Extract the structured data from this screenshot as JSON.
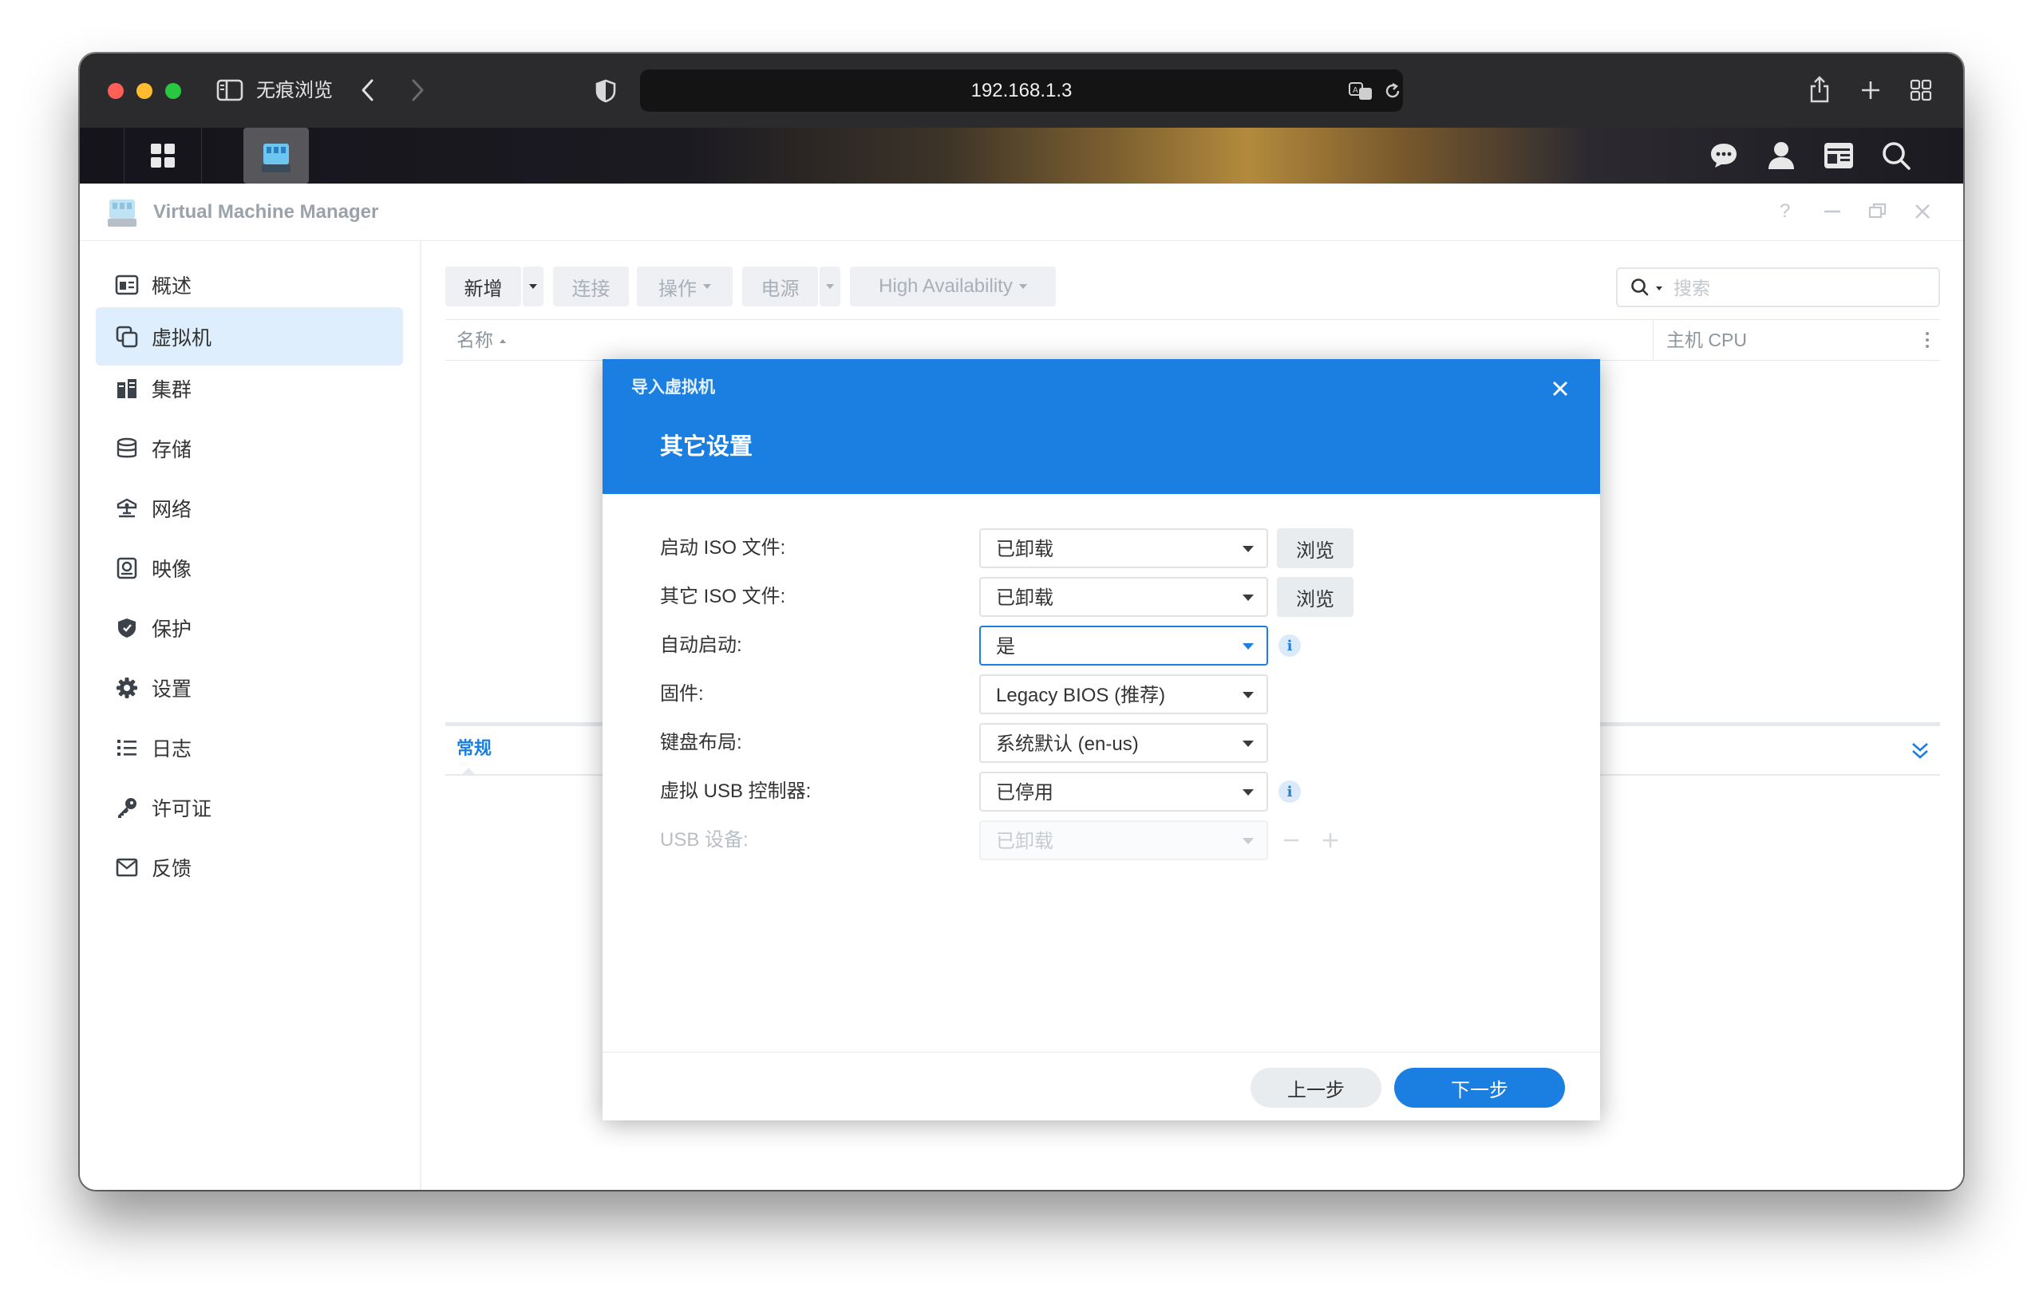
{
  "browser": {
    "private_label": "无痕浏览",
    "url": "192.168.1.3"
  },
  "app": {
    "title": "Virtual Machine Manager",
    "help": "?"
  },
  "sidebar": {
    "items": [
      {
        "label": "概述",
        "icon": "overview-icon"
      },
      {
        "label": "虚拟机",
        "icon": "virtual-machine-icon",
        "active": true
      },
      {
        "label": "集群",
        "icon": "cluster-icon"
      },
      {
        "label": "存储",
        "icon": "storage-icon"
      },
      {
        "label": "网络",
        "icon": "network-icon"
      },
      {
        "label": "映像",
        "icon": "image-icon"
      },
      {
        "label": "保护",
        "icon": "shield-icon"
      },
      {
        "label": "设置",
        "icon": "gear-icon"
      },
      {
        "label": "日志",
        "icon": "list-icon"
      },
      {
        "label": "许可证",
        "icon": "key-icon"
      },
      {
        "label": "反馈",
        "icon": "mail-icon"
      }
    ]
  },
  "toolbar": {
    "create": "新增",
    "connect": "连接",
    "action": "操作",
    "power": "电源",
    "ha": "High Availability",
    "search_placeholder": "搜索"
  },
  "grid": {
    "col_name": "名称",
    "col_host_cpu": "主机 CPU"
  },
  "lower_panel": {
    "tab_general": "常规"
  },
  "dialog": {
    "window_title": "导入虚拟机",
    "step_title": "其它设置",
    "rows": {
      "boot_iso": {
        "label": "启动 ISO 文件:",
        "value": "已卸载",
        "button": "浏览"
      },
      "other_iso": {
        "label": "其它 ISO 文件:",
        "value": "已卸载",
        "button": "浏览"
      },
      "autostart": {
        "label": "自动启动:",
        "value": "是"
      },
      "firmware": {
        "label": "固件:",
        "value": "Legacy BIOS (推荐)"
      },
      "keyboard": {
        "label": "键盘布局:",
        "value": "系统默认 (en-us)"
      },
      "usb_controller": {
        "label": "虚拟 USB 控制器:",
        "value": "已停用"
      },
      "usb_device": {
        "label": "USB 设备:",
        "value": "已卸载"
      }
    },
    "info_glyph": "i",
    "prev": "上一步",
    "next": "下一步"
  },
  "colors": {
    "accent": "#1a7fe0",
    "sidebar_active": "#deeefc",
    "titlebar": "#2b2b2d"
  }
}
